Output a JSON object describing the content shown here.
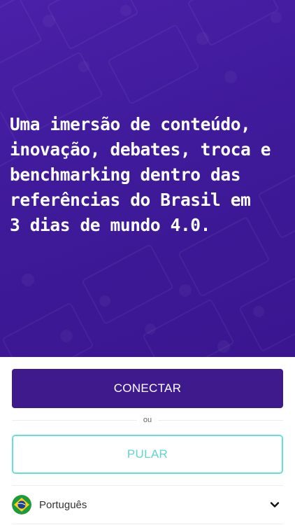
{
  "hero": {
    "text": "Uma imersão de conteúdo,\ninovação, debates, troca e\nbenchmarking dentro das\nreferências do Brasil em\n3 dias de mundo 4.0."
  },
  "actions": {
    "connect_label": "CONECTAR",
    "separator_label": "ou",
    "skip_label": "PULAR"
  },
  "language": {
    "selected": "Português",
    "flag_icon": "brazil-flag-icon",
    "dropdown_icon": "chevron-down-icon"
  },
  "colors": {
    "hero_background": "#3f1a9a",
    "primary_button": "#3e1a8c",
    "secondary_accent": "#5fd7cc"
  }
}
